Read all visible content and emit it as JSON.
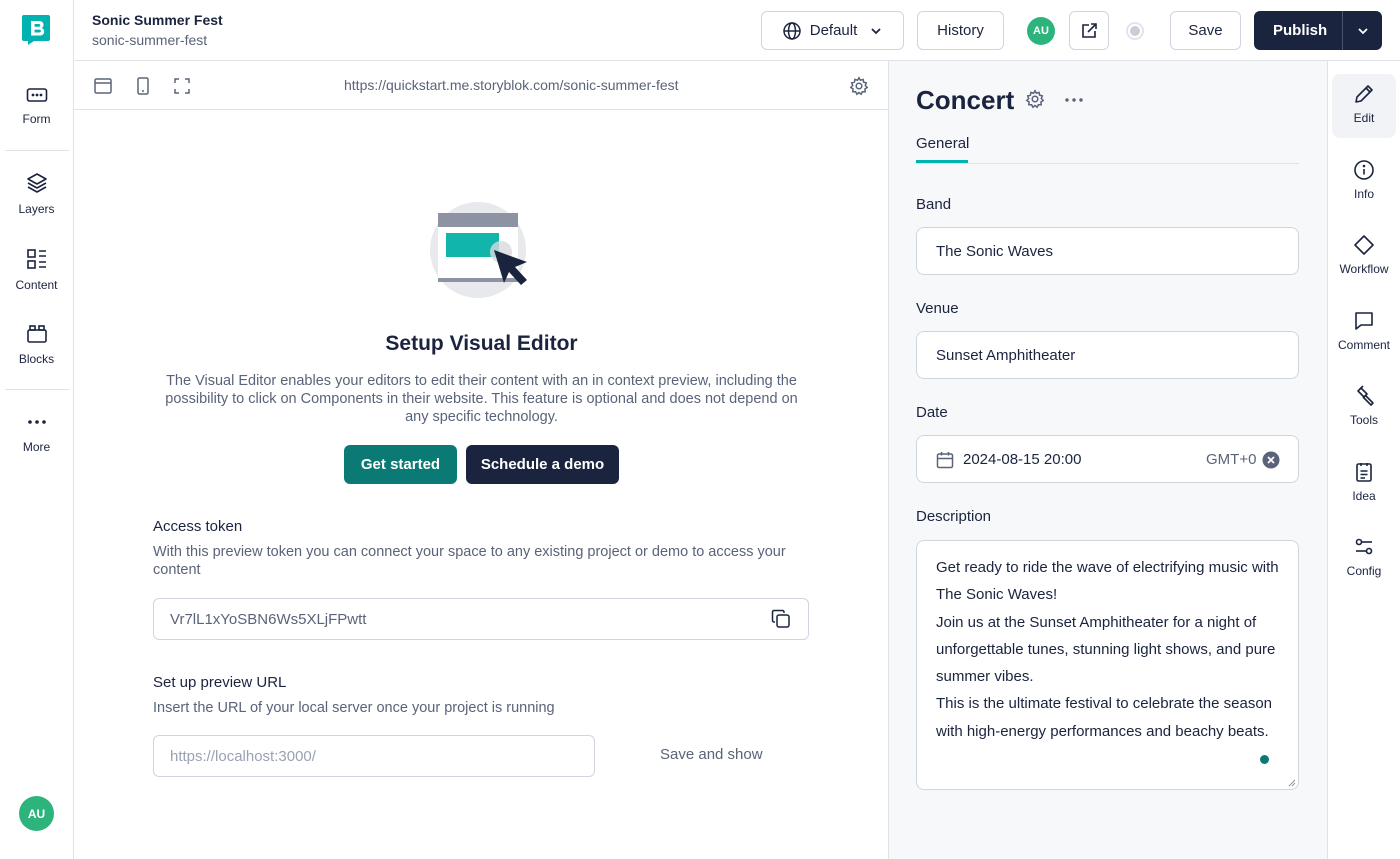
{
  "story": {
    "name": "Sonic Summer Fest",
    "slug": "sonic-summer-fest"
  },
  "left_nav": [
    {
      "label": "Form",
      "icon": "form-icon"
    },
    {
      "label": "Layers",
      "icon": "layers-icon"
    },
    {
      "label": "Content",
      "icon": "content-icon"
    },
    {
      "label": "Blocks",
      "icon": "blocks-icon"
    },
    {
      "label": "More",
      "icon": "more-icon"
    }
  ],
  "user": {
    "initials": "AU"
  },
  "toolbar": {
    "language_label": "Default",
    "history_label": "History",
    "save_label": "Save",
    "publish_label": "Publish"
  },
  "preview": {
    "url": "https://quickstart.me.storyblok.com/sonic-summer-fest",
    "setup_title": "Setup Visual Editor",
    "setup_description": "The Visual Editor enables your editors to edit their content with an in context preview, including the possibility to click on Components in their website. This feature is optional and does not depend on any specific technology.",
    "get_started_label": "Get started",
    "schedule_demo_label": "Schedule a demo",
    "access_token_title": "Access token",
    "access_token_description": "With this preview token you can connect your space to any existing project or demo to access your content",
    "access_token_value": "Vr7lL1xYoSBN6Ws5XLjFPwtt",
    "preview_url_title": "Set up preview URL",
    "preview_url_description": "Insert the URL of your local server once your project is running",
    "preview_url_placeholder": "https://localhost:3000/",
    "save_and_show_label": "Save and show"
  },
  "editor": {
    "component_name": "Concert",
    "tab_general": "General",
    "fields": {
      "band": {
        "label": "Band",
        "value": "The Sonic Waves"
      },
      "venue": {
        "label": "Venue",
        "value": "Sunset Amphitheater"
      },
      "date": {
        "label": "Date",
        "value": "2024-08-15 20:00",
        "timezone": "GMT+0"
      },
      "description": {
        "label": "Description",
        "lines": [
          "Get ready to ride the wave of electrifying music with The Sonic Waves!",
          "Join us at the Sunset Amphitheater for a night of unforgettable tunes, stunning light shows, and pure summer vibes.",
          "This is the ultimate festival to celebrate the season with high-energy performances and beachy beats."
        ]
      }
    }
  },
  "right_nav": [
    {
      "label": "Edit",
      "icon": "pencil-icon"
    },
    {
      "label": "Info",
      "icon": "info-icon"
    },
    {
      "label": "Workflow",
      "icon": "workflow-icon"
    },
    {
      "label": "Comment",
      "icon": "comment-icon"
    },
    {
      "label": "Tools",
      "icon": "tools-icon"
    },
    {
      "label": "Idea",
      "icon": "idea-icon"
    },
    {
      "label": "Config",
      "icon": "config-icon"
    }
  ],
  "colors": {
    "brand_teal": "#00b3b0",
    "primary_button": "#0b7a74",
    "dark_navy": "#1b243f",
    "avatar_green": "#2db47d"
  }
}
